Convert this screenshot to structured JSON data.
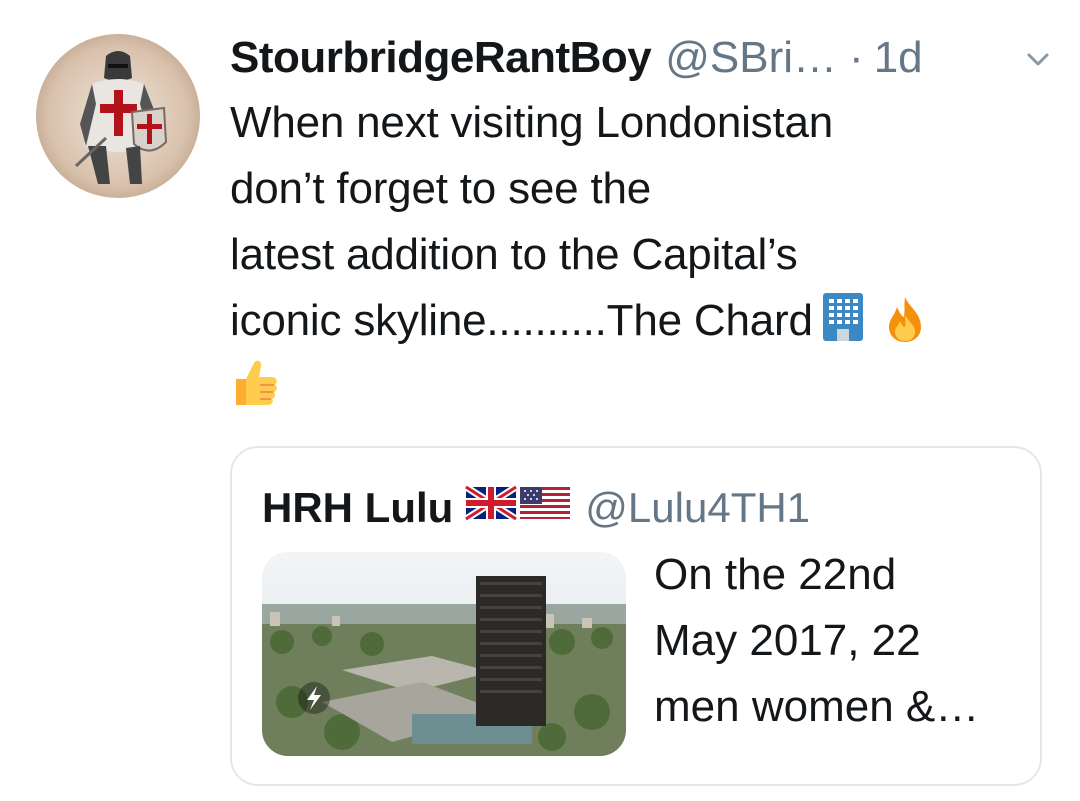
{
  "tweet": {
    "display_name": "StourbridgeRantBoy",
    "handle": "@SBri…",
    "separator": "·",
    "time": "1d",
    "text_lines": [
      "When next visiting Londonistan",
      "don’t forget to see the",
      "latest addition to the Capital’s",
      "iconic skyline..........The Chard"
    ],
    "emojis": [
      "office-building-emoji",
      "fire-emoji",
      "thumbs-up-emoji"
    ]
  },
  "quoted_tweet": {
    "display_name": "HRH Lulu",
    "flags": [
      "uk-flag-emoji",
      "us-flag-emoji"
    ],
    "handle": "@Lulu4TH1",
    "text_lines": [
      "On the 22nd",
      "May 2017, 22",
      "men women &…"
    ],
    "media": "tower-block-photo"
  },
  "colors": {
    "text": "#14171a",
    "secondary": "#657786",
    "border": "#e1e8ed"
  }
}
